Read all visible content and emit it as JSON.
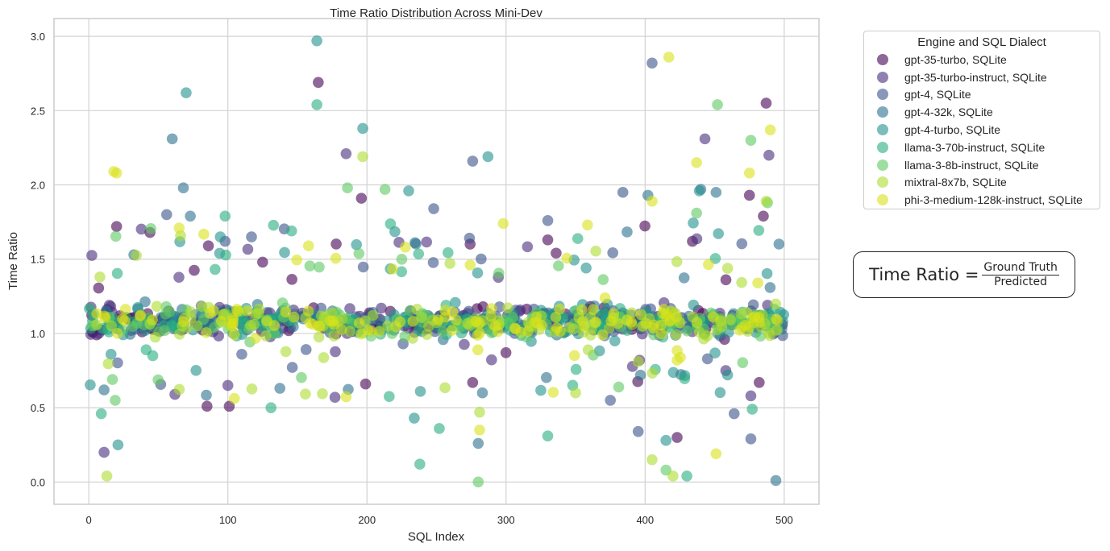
{
  "chart_data": {
    "type": "scatter",
    "title": "Time Ratio Distribution Across Mini-Dev",
    "xlabel": "SQL Index",
    "ylabel": "Time Ratio",
    "xlim": [
      -25,
      525
    ],
    "ylim": [
      -0.15,
      3.12
    ],
    "x_ticks": [
      0,
      100,
      200,
      300,
      400,
      500
    ],
    "y_ticks": [
      0.0,
      0.5,
      1.0,
      1.5,
      2.0,
      2.5,
      3.0
    ],
    "x_tick_labels": [
      "0",
      "100",
      "200",
      "300",
      "400",
      "500"
    ],
    "y_tick_labels": [
      "0.0",
      "0.5",
      "1.0",
      "1.5",
      "2.0",
      "2.5",
      "3.0"
    ],
    "grid": true,
    "legend_title": "Engine and SQL Dialect",
    "legend_position": "outside-top-right",
    "annotation": {
      "lhs": "Time Ratio",
      "equals": "=",
      "numerator": "Ground Truth",
      "denominator": "Predicted"
    },
    "series": [
      {
        "name": "gpt-35-turbo, SQLite",
        "color": "#440154",
        "outliers": [
          [
            165,
            2.69
          ],
          [
            487,
            2.55
          ],
          [
            20,
            1.72
          ],
          [
            44,
            1.68
          ],
          [
            86,
            1.59
          ],
          [
            125,
            1.48
          ],
          [
            196,
            1.91
          ],
          [
            330,
            1.63
          ],
          [
            434,
            1.62
          ],
          [
            475,
            1.93
          ],
          [
            482,
            0.67
          ],
          [
            276,
            0.67
          ],
          [
            199,
            0.66
          ],
          [
            423,
            0.3
          ],
          [
            85,
            0.51
          ],
          [
            101,
            0.51
          ],
          [
            485,
            1.79
          ]
        ]
      },
      {
        "name": "gpt-35-turbo-instruct, SQLite",
        "color": "#472d7b",
        "outliers": [
          [
            185,
            2.21
          ],
          [
            11,
            0.2
          ],
          [
            177,
            0.57
          ],
          [
            396,
            0.82
          ],
          [
            489,
            2.2
          ],
          [
            100,
            0.65
          ],
          [
            488,
            1.19
          ],
          [
            476,
            0.58
          ],
          [
            458,
            0.75
          ],
          [
            443,
            2.31
          ]
        ]
      },
      {
        "name": "gpt-4, SQLite",
        "color": "#3b528b",
        "outliers": [
          [
            405,
            2.82
          ],
          [
            56,
            1.8
          ],
          [
            98,
            1.62
          ],
          [
            117,
            1.65
          ],
          [
            248,
            1.84
          ],
          [
            276,
            2.16
          ],
          [
            330,
            1.76
          ],
          [
            384,
            1.95
          ],
          [
            464,
            0.46
          ],
          [
            375,
            0.55
          ],
          [
            395,
            0.34
          ],
          [
            476,
            0.29
          ],
          [
            110,
            0.86
          ],
          [
            226,
            0.93
          ]
        ]
      },
      {
        "name": "gpt-4-32k, SQLite",
        "color": "#2c728e",
        "outliers": [
          [
            60,
            2.31
          ],
          [
            68,
            1.98
          ],
          [
            73,
            1.79
          ],
          [
            280,
            0.26
          ],
          [
            283,
            0.6
          ],
          [
            494,
            0.01
          ],
          [
            402,
            1.93
          ],
          [
            11,
            0.62
          ],
          [
            440,
            1.97
          ],
          [
            451,
            1.95
          ]
        ]
      },
      {
        "name": "gpt-4-turbo, SQLite",
        "color": "#21918c",
        "outliers": [
          [
            164,
            2.97
          ],
          [
            70,
            2.62
          ],
          [
            197,
            2.38
          ],
          [
            21,
            0.25
          ],
          [
            230,
            1.96
          ],
          [
            287,
            2.19
          ],
          [
            439,
            1.96
          ],
          [
            415,
            0.28
          ],
          [
            16,
            0.86
          ],
          [
            234,
            0.43
          ]
        ]
      },
      {
        "name": "llama-3-70b-instruct, SQLite",
        "color": "#28ae80",
        "outliers": [
          [
            164,
            2.54
          ],
          [
            98,
            1.79
          ],
          [
            9,
            0.46
          ],
          [
            131,
            0.5
          ],
          [
            238,
            0.12
          ],
          [
            252,
            0.36
          ],
          [
            330,
            0.31
          ],
          [
            430,
            0.04
          ],
          [
            477,
            0.49
          ],
          [
            46,
            0.85
          ]
        ]
      },
      {
        "name": "llama-3-8b-instruct, SQLite",
        "color": "#5ec962",
        "outliers": [
          [
            186,
            1.98
          ],
          [
            17,
            0.69
          ],
          [
            19,
            0.55
          ],
          [
            213,
            1.97
          ],
          [
            280,
            0.0
          ],
          [
            415,
            0.08
          ],
          [
            452,
            2.54
          ],
          [
            476,
            2.3
          ],
          [
            437,
            1.81
          ],
          [
            488,
            1.88
          ]
        ]
      },
      {
        "name": "mixtral-8x7b, SQLite",
        "color": "#addc30",
        "outliers": [
          [
            13,
            0.04
          ],
          [
            8,
            1.38
          ],
          [
            197,
            2.19
          ],
          [
            395,
            0.81
          ],
          [
            405,
            0.15
          ],
          [
            350,
            0.6
          ],
          [
            281,
            0.47
          ],
          [
            420,
            0.04
          ],
          [
            487,
            1.89
          ]
        ]
      },
      {
        "name": "phi-3-medium-128k-instruct, SQLite",
        "color": "#d8e219",
        "outliers": [
          [
            18,
            2.09
          ],
          [
            20,
            2.08
          ],
          [
            417,
            2.86
          ],
          [
            490,
            2.37
          ],
          [
            437,
            2.15
          ],
          [
            475,
            2.08
          ],
          [
            451,
            0.19
          ],
          [
            281,
            0.35
          ],
          [
            65,
            1.71
          ],
          [
            158,
            1.59
          ],
          [
            298,
            1.74
          ],
          [
            405,
            1.89
          ],
          [
            481,
            1.34
          ],
          [
            423,
            0.82
          ]
        ]
      }
    ],
    "cluster": {
      "center_range": [
        0.9,
        1.35
      ],
      "x_range": [
        0,
        500
      ],
      "points_per_series": 120
    }
  }
}
